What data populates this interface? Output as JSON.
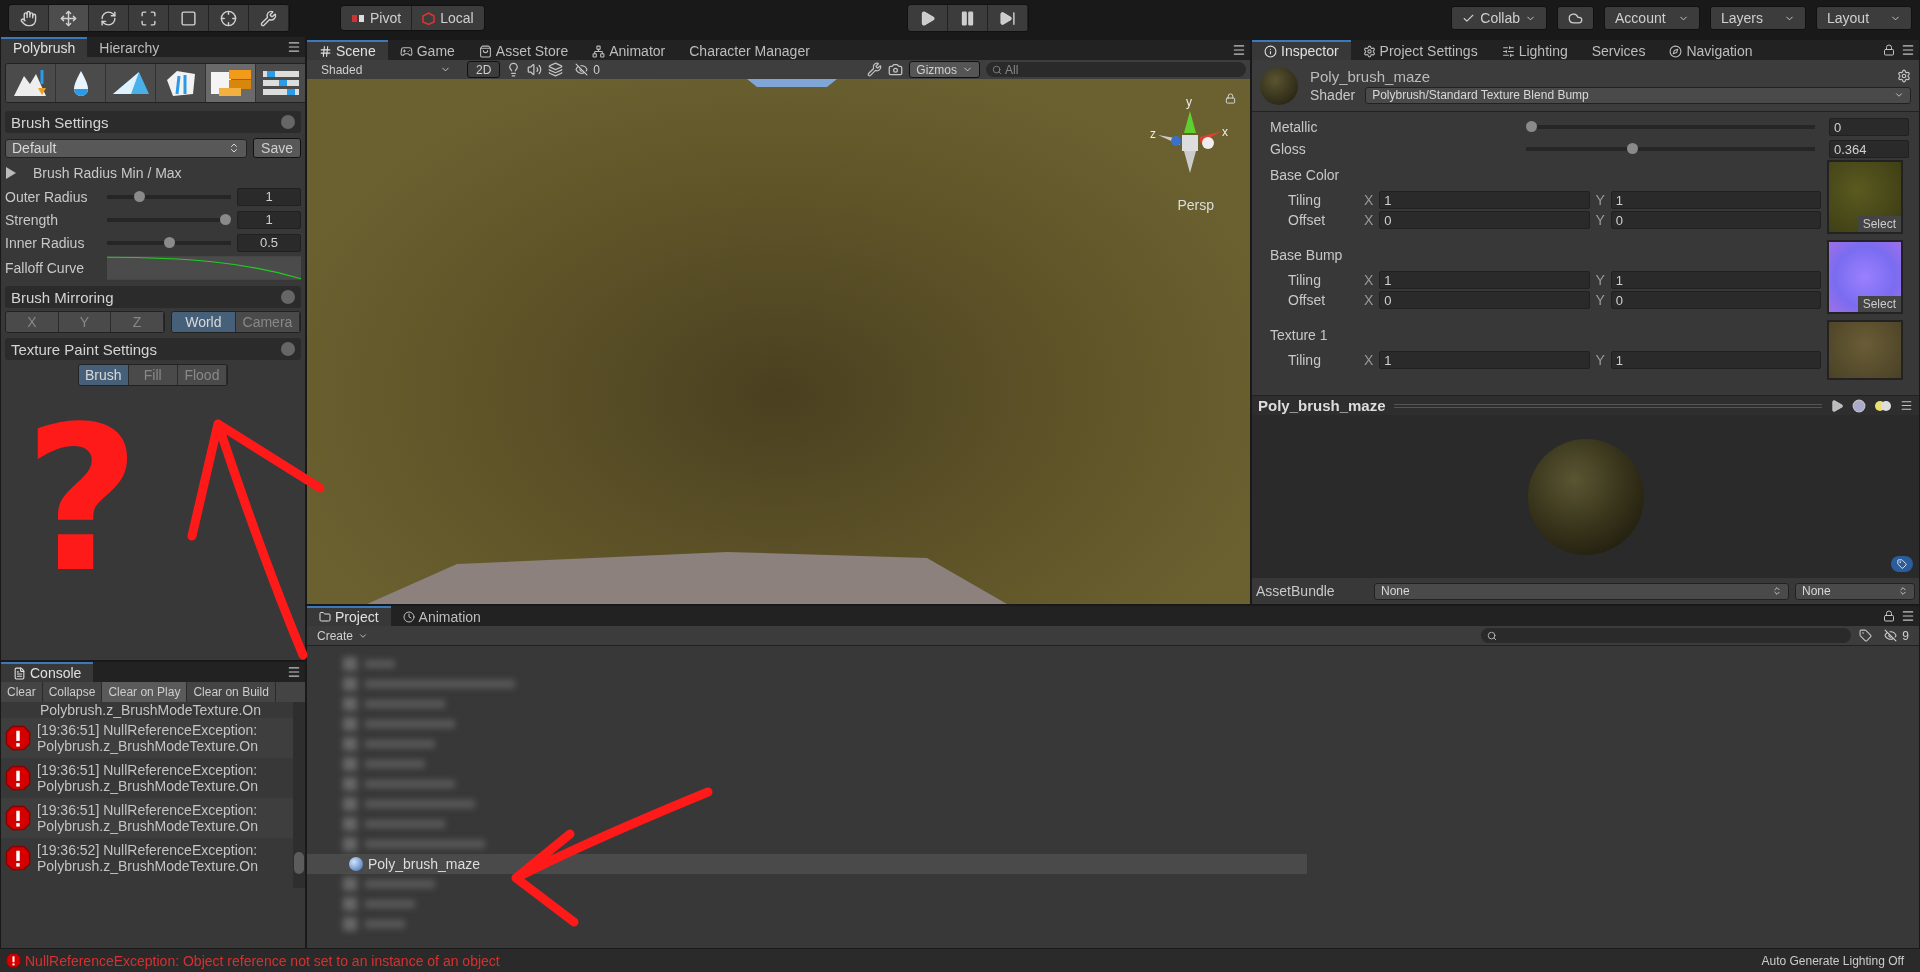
{
  "toolbar": {
    "tools": [
      {
        "selected": false
      },
      {
        "selected": true
      },
      {
        "selected": false
      },
      {
        "selected": false
      },
      {
        "selected": false
      },
      {
        "selected": false
      },
      {
        "selected": false
      }
    ],
    "pivot": "Pivot",
    "local": "Local",
    "collab": "Collab",
    "account": "Account",
    "layers": "Layers",
    "layout": "Layout"
  },
  "polybrush_window": {
    "tabs": [
      {
        "label": "Polybrush",
        "selected": true
      },
      {
        "label": "Hierarchy",
        "selected": false
      }
    ],
    "modes": [
      {
        "selected": false
      },
      {
        "selected": false
      },
      {
        "selected": false
      },
      {
        "selected": false
      },
      {
        "selected": true
      },
      {
        "selected": false
      }
    ]
  },
  "brush_settings": {
    "title": "Brush Settings",
    "preset": "Default",
    "save": "Save",
    "foldout": {
      "label": "Brush Radius Min / Max",
      "expanded": false
    },
    "sliders": [
      {
        "label": "Outer Radius",
        "level": 0.24,
        "value": "1"
      },
      {
        "label": "Strength",
        "level": 1,
        "value": "1"
      },
      {
        "label": "Inner Radius",
        "level": 0.5,
        "value": "0.5"
      }
    ],
    "falloff_label": "Falloff Curve"
  },
  "brush_mirroring": {
    "title": "Brush Mirroring",
    "axes": [
      {
        "label": "X",
        "selected": false
      },
      {
        "label": "Y",
        "selected": false
      },
      {
        "label": "Z",
        "selected": false
      }
    ],
    "spaces": [
      {
        "label": "World",
        "selected": true
      },
      {
        "label": "Camera",
        "selected": false
      }
    ]
  },
  "texture_paint_settings": {
    "title": "Texture Paint Settings",
    "modes": [
      {
        "label": "Brush",
        "selected": true
      },
      {
        "label": "Fill",
        "selected": false
      },
      {
        "label": "Flood",
        "selected": false
      }
    ]
  },
  "annotations": {
    "question_mark": "?"
  },
  "console": {
    "tab": "Console",
    "buttons": [
      {
        "label": "Clear",
        "selected": false
      },
      {
        "label": "Collapse",
        "selected": false
      },
      {
        "label": "Clear on Play",
        "selected": true
      },
      {
        "label": "Clear on Build",
        "selected": false
      }
    ],
    "clipped_line": "Polybrush.z_BrushModeTexture.On",
    "entries": [
      {
        "kind": "error",
        "line1": "[19:36:51] NullReferenceException:",
        "line2": "Polybrush.z_BrushModeTexture.On"
      },
      {
        "kind": "error",
        "line1": "[19:36:51] NullReferenceException:",
        "line2": "Polybrush.z_BrushModeTexture.On"
      },
      {
        "kind": "error",
        "line1": "[19:36:51] NullReferenceException:",
        "line2": "Polybrush.z_BrushModeTexture.On"
      },
      {
        "kind": "error",
        "line1": "[19:36:52] NullReferenceException:",
        "line2": "Polybrush.z_BrushModeTexture.On"
      }
    ]
  },
  "scene_window": {
    "tabs": [
      {
        "label": "Scene",
        "selected": true
      },
      {
        "label": "Game",
        "selected": false
      },
      {
        "label": "Asset Store",
        "selected": false
      },
      {
        "label": "Animator",
        "selected": false
      },
      {
        "label": "Character Manager",
        "selected": false
      }
    ],
    "shading": "Shaded",
    "mode_2d": "2D",
    "hidden_count": "0",
    "gizmos": "Gizmos",
    "search": {
      "placeholder": "All"
    },
    "gizmo": {
      "axes": [
        "y",
        "x",
        "z"
      ],
      "projection": "Persp"
    }
  },
  "inspector": {
    "tabs": [
      {
        "label": "Inspector",
        "selected": true
      },
      {
        "label": "Project Settings",
        "selected": false
      },
      {
        "label": "Lighting",
        "selected": false
      },
      {
        "label": "Services",
        "selected": false
      },
      {
        "label": "Navigation",
        "selected": false
      }
    ],
    "material": {
      "name": "Poly_brush_maze",
      "shader_label": "Shader",
      "shader": "Polybrush/Standard Texture Blend Bump"
    },
    "sliders": [
      {
        "label": "Metallic",
        "level": 0,
        "value": "0"
      },
      {
        "label": "Gloss",
        "level": 0.364,
        "value": "0.364"
      }
    ],
    "textures": [
      {
        "label": "Base Color",
        "kind": "albedo",
        "select": "Select",
        "rows": [
          {
            "label": "Tiling",
            "fields": [
              {
                "axis": "X",
                "value": "1"
              },
              {
                "axis": "Y",
                "value": "1"
              }
            ]
          },
          {
            "label": "Offset",
            "fields": [
              {
                "axis": "X",
                "value": "0"
              },
              {
                "axis": "Y",
                "value": "0"
              }
            ]
          }
        ]
      },
      {
        "label": "Base Bump",
        "kind": "normal",
        "select": "Select",
        "rows": [
          {
            "label": "Tiling",
            "fields": [
              {
                "axis": "X",
                "value": "1"
              },
              {
                "axis": "Y",
                "value": "1"
              }
            ]
          },
          {
            "label": "Offset",
            "fields": [
              {
                "axis": "X",
                "value": "0"
              },
              {
                "axis": "Y",
                "value": "0"
              }
            ]
          }
        ]
      },
      {
        "label": "Texture 1",
        "kind": "dirt",
        "rows": [
          {
            "label": "Tiling",
            "fields": [
              {
                "axis": "X",
                "value": "1"
              },
              {
                "axis": "Y",
                "value": "1"
              }
            ]
          }
        ]
      }
    ],
    "preview_title": "Poly_brush_maze",
    "asset_bundle": {
      "label": "AssetBundle",
      "name": "None",
      "variant": "None"
    }
  },
  "project": {
    "tabs": [
      {
        "label": "Project",
        "selected": true
      },
      {
        "label": "Animation",
        "selected": false
      }
    ],
    "create": "Create",
    "hidden_count": "9",
    "items": [
      {
        "name": "Poly_brush_maze",
        "selected": true
      }
    ]
  },
  "status_bar": {
    "error": "NullReferenceException: Object reference not set to an instance of an object",
    "lighting": "Auto Generate Lighting Off"
  }
}
